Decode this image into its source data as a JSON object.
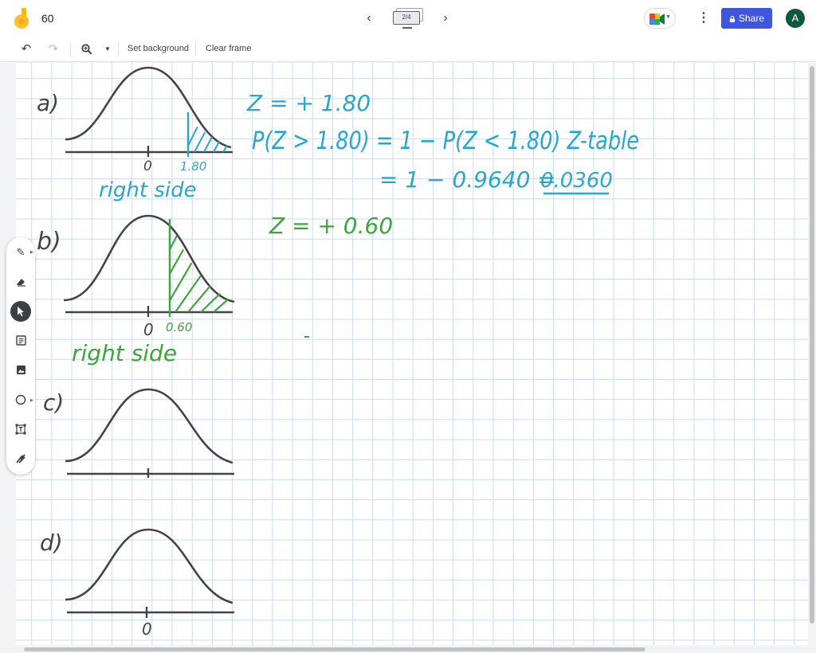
{
  "header": {
    "doc_title": "60",
    "frame_counter": "2/4",
    "share_label": "Share",
    "avatar_initial": "A",
    "prev_icon": "chevron-left-icon",
    "next_icon": "chevron-right-icon",
    "more_icon": "more-vert-icon"
  },
  "toolbar": {
    "undo_icon": "undo-icon",
    "redo_icon": "redo-icon",
    "zoom_icon": "zoom-icon",
    "set_background_label": "Set background",
    "clear_frame_label": "Clear frame"
  },
  "side_tools": [
    {
      "name": "pen",
      "icon": "pen-icon"
    },
    {
      "name": "eraser",
      "icon": "eraser-icon"
    },
    {
      "name": "select",
      "icon": "select-arrow-icon",
      "active": true
    },
    {
      "name": "sticky-note",
      "icon": "sticky-note-icon"
    },
    {
      "name": "image",
      "icon": "image-icon"
    },
    {
      "name": "shape",
      "icon": "circle-icon"
    },
    {
      "name": "text-box",
      "icon": "text-box-icon"
    },
    {
      "name": "laser",
      "icon": "laser-icon"
    }
  ],
  "board": {
    "colors": {
      "ink": "#444444",
      "blue": "#2aa6c8",
      "green": "#3ea33e"
    },
    "part_a": {
      "label": "a)",
      "zero": "0",
      "z_tick": "1.80",
      "side": "right side"
    },
    "part_b": {
      "label": "b)",
      "zero": "0",
      "z_tick": "0.60",
      "side": "right side"
    },
    "part_c": {
      "label": "c)"
    },
    "part_d": {
      "label": "d)",
      "zero": "0"
    },
    "work_a": {
      "line1": "Z = + 1.80",
      "line2": "P(Z > 1.80) = 1 − P(Z < 1.80)  Z-table",
      "line3": "= 1 − 0.9640 =",
      "answer": "0.0360"
    },
    "work_b": {
      "line1": "Z = + 0.60"
    }
  }
}
